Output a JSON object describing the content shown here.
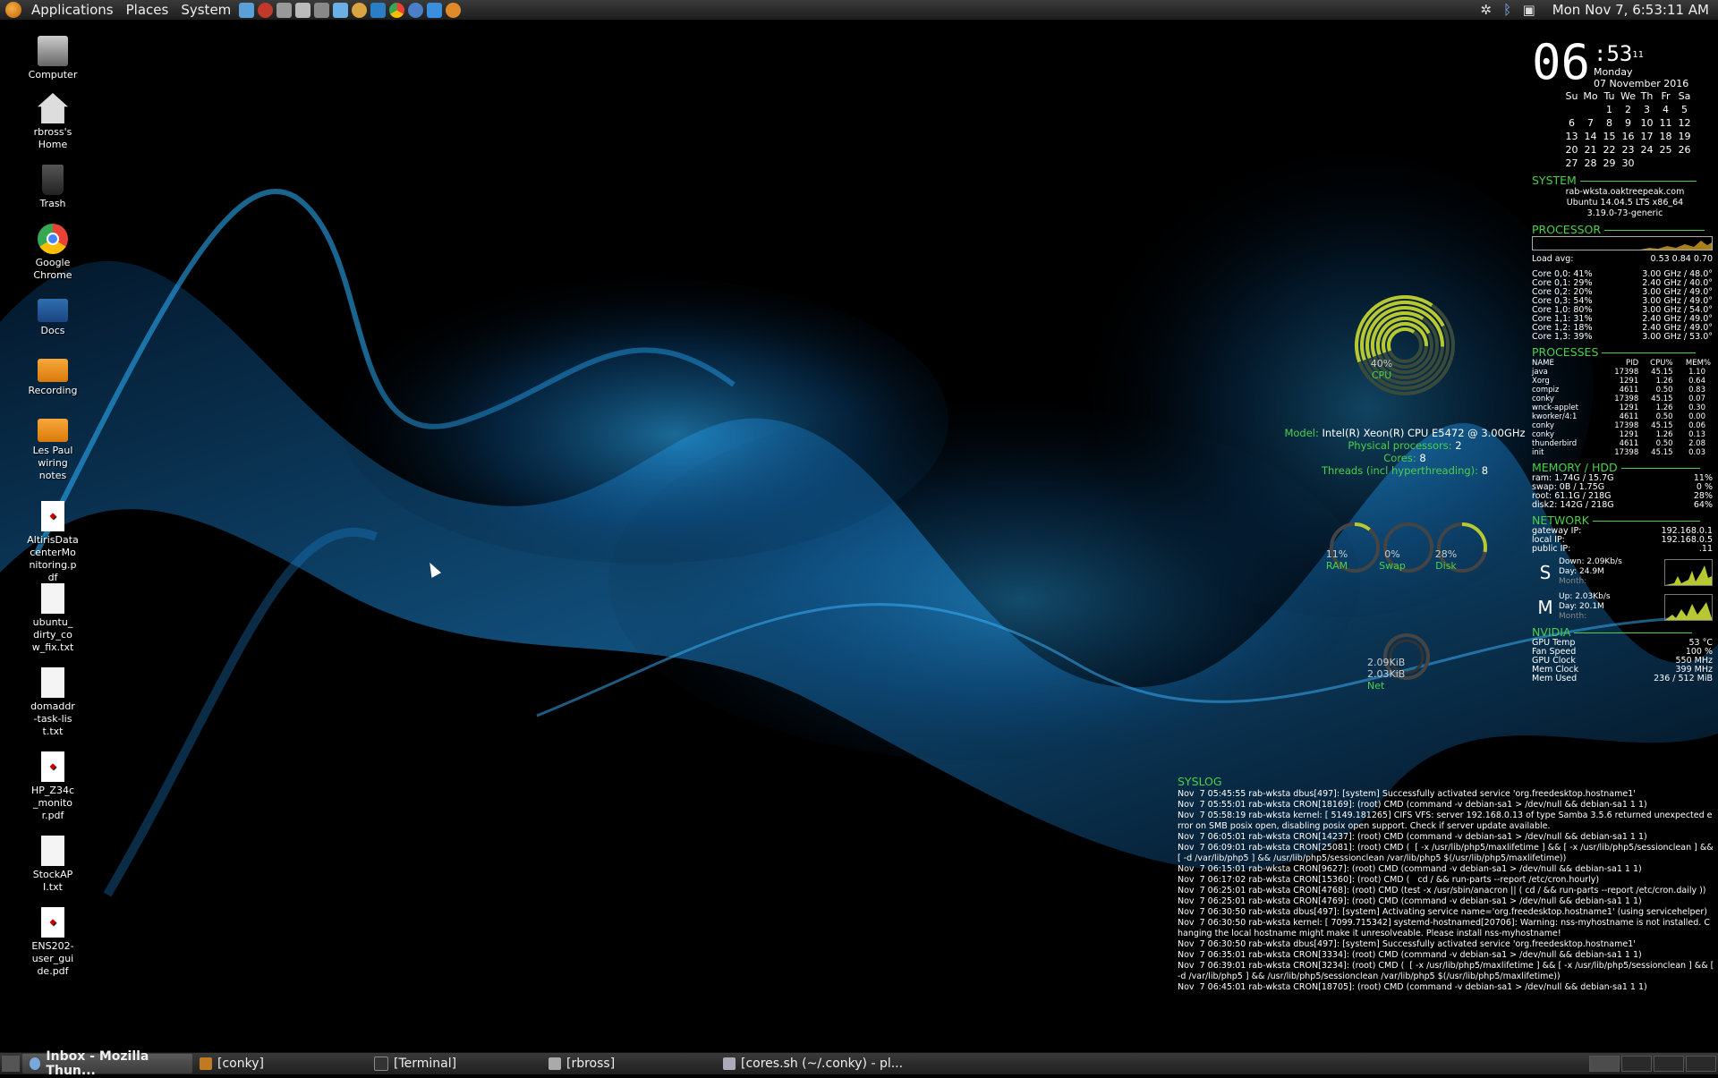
{
  "top_panel": {
    "menus": [
      "Applications",
      "Places",
      "System"
    ],
    "launchers": [
      "virtualbox-icon",
      "app-icon",
      "screenshot-icon",
      "files-icon",
      "window-icon",
      "chromium-icon",
      "thunderbird-icon",
      "network-icon",
      "chrome-icon",
      "firefox-icon",
      "writer-icon",
      "updater-icon"
    ],
    "datetime": "Mon Nov  7,  6:53:11 AM"
  },
  "desktop_icons": [
    {
      "label": "Computer",
      "icon": "computer-icon"
    },
    {
      "label": "rbross's Home",
      "icon": "home-icon"
    },
    {
      "label": "Trash",
      "icon": "trash-icon"
    },
    {
      "label": "Google Chrome",
      "icon": "chrome-icon"
    },
    {
      "label": "Docs",
      "icon": "folder-link-icon"
    },
    {
      "label": "Recording",
      "icon": "folder-icon"
    },
    {
      "label": "Les Paul wiring notes",
      "icon": "folder-icon"
    },
    {
      "label": "AltirisDatacenterMonitoring.pdf",
      "icon": "pdf-icon"
    },
    {
      "label": "ubuntu_dirty_cow_fix.txt",
      "icon": "text-file-icon"
    },
    {
      "label": "domaddr-task-list.txt",
      "icon": "text-file-icon"
    },
    {
      "label": "HP_Z34c_monitor.pdf",
      "icon": "pdf-icon"
    },
    {
      "label": "StockAPI.txt",
      "icon": "text-file-icon"
    },
    {
      "label": "ENS202-user_guide.pdf",
      "icon": "pdf-icon"
    }
  ],
  "conky": {
    "clock": {
      "hour": "06",
      "minute": ":53",
      "second": "11",
      "weekday": "Monday",
      "date": "07 November 2016"
    },
    "calendar": {
      "headers": [
        "Su",
        "Mo",
        "Tu",
        "We",
        "Th",
        "Fr",
        "Sa"
      ],
      "weeks": [
        [
          "",
          "",
          "1",
          "2",
          "3",
          "4",
          "5"
        ],
        [
          "6",
          "7",
          "8",
          "9",
          "10",
          "11",
          "12"
        ],
        [
          "13",
          "14",
          "15",
          "16",
          "17",
          "18",
          "19"
        ],
        [
          "20",
          "21",
          "22",
          "23",
          "24",
          "25",
          "26"
        ],
        [
          "27",
          "28",
          "29",
          "30",
          "",
          "",
          ""
        ]
      ]
    },
    "system": {
      "title": "SYSTEM",
      "host": "rab-wksta.oaktreepeak.com",
      "os": "Ubuntu 14.04.5 LTS x86_64",
      "kernel": "3.19.0-73-generic"
    },
    "processor": {
      "title": "PROCESSOR",
      "load_label": "Load avg:",
      "load_value": "0.53 0.84 0.70",
      "cores": [
        {
          "name": "Core 0,0:",
          "pct": "41%",
          "freq": "3.00 GHz / 48.0°"
        },
        {
          "name": "Core 0,1:",
          "pct": "29%",
          "freq": "2.40 GHz / 40.0°"
        },
        {
          "name": "Core 0,2:",
          "pct": "20%",
          "freq": "3.00 GHz / 49.0°"
        },
        {
          "name": "Core 0,3:",
          "pct": "54%",
          "freq": "3.00 GHz / 49.0°"
        },
        {
          "name": "Core 1,0:",
          "pct": "80%",
          "freq": "3.00 GHz / 54.0°"
        },
        {
          "name": "Core 1,1:",
          "pct": "31%",
          "freq": "2.40 GHz / 49.0°"
        },
        {
          "name": "Core 1,2:",
          "pct": "18%",
          "freq": "2.40 GHz / 49.0°"
        },
        {
          "name": "Core 1,3:",
          "pct": "39%",
          "freq": "3.00 GHz / 53.0°"
        }
      ]
    },
    "processes": {
      "title": "PROCESSES",
      "headers": [
        "NAME",
        "PID",
        "CPU%",
        "MEM%"
      ],
      "rows": [
        [
          "java",
          "17398",
          "45.15",
          "1.10"
        ],
        [
          "Xorg",
          "1291",
          "1.26",
          "0.64"
        ],
        [
          "compiz",
          "4611",
          "0.50",
          "0.83"
        ],
        [
          "conky",
          "17398",
          "45.15",
          "0.07"
        ],
        [
          "wnck-applet",
          "1291",
          "1.26",
          "0.30"
        ],
        [
          "kworker/4:1",
          "4611",
          "0.50",
          "0.00"
        ],
        [
          "conky",
          "17398",
          "45.15",
          "0.06"
        ],
        [
          "conky",
          "1291",
          "1.26",
          "0.13"
        ],
        [
          "thunderbird",
          "4611",
          "0.50",
          "2.08"
        ],
        [
          "init",
          "17398",
          "45.15",
          "0.03"
        ]
      ]
    },
    "memory": {
      "title": "MEMORY / HDD",
      "rows": [
        {
          "label": "ram: 1.74G / 15.7G",
          "value": "11%"
        },
        {
          "label": "swap: 0B   / 1.75G",
          "value": "0 %"
        },
        {
          "label": "root: 61.1G / 218G",
          "value": "28%"
        },
        {
          "label": "disk2: 142G  / 218G",
          "value": "64%"
        }
      ]
    },
    "network": {
      "title": "NETWORK",
      "rows": [
        {
          "label": "gateway IP:",
          "value": "192.168.0.1"
        },
        {
          "label": "local IP:",
          "value": "192.168.0.5"
        },
        {
          "label": "public IP:",
          "value": ".11"
        }
      ],
      "down": {
        "letter": "S",
        "line1": "Down: 2.09Kb/s",
        "line2": "Day: 24.9M",
        "line3": "Month:"
      },
      "up": {
        "letter": "M",
        "line1": "Up: 2.03Kb/s",
        "line2": "Day: 20.1M",
        "line3": "Month:"
      }
    },
    "nvidia": {
      "title": "NVIDIA",
      "rows": [
        {
          "label": "GPU Temp",
          "value": "53  °C"
        },
        {
          "label": "Fan Speed",
          "value": "100 %"
        },
        {
          "label": "GPU Clock",
          "value": "550 MHz"
        },
        {
          "label": "Mem Clock",
          "value": "399 MHz"
        },
        {
          "label": "Mem Used",
          "value": "236 / 512 MiB"
        }
      ]
    },
    "cpu_ring": {
      "pct": "40%",
      "label": "CPU",
      "level": 0.4
    },
    "cpu_info": {
      "model_label": "Model:",
      "model": "Intel(R) Xeon(R) CPU E5472 @ 3.00GHz",
      "phys_label": "Physical processors:",
      "phys": "2",
      "cores_label": "Cores:",
      "cores": "8",
      "threads_label": "Threads (incl hyperthreading):",
      "threads": "8"
    },
    "rings": [
      {
        "pct": "11%",
        "label": "RAM",
        "level": 0.11
      },
      {
        "pct": "0%",
        "label": "Swap",
        "level": 0.0
      },
      {
        "pct": "28%",
        "label": "Disk",
        "level": 0.28
      }
    ],
    "net_ring": {
      "down": "2.09KiB",
      "up": "2.03KiB",
      "label": "Net"
    }
  },
  "syslog": {
    "title": "SYSLOG",
    "lines": [
      "Nov  7 05:45:55 rab-wksta dbus[497]: [system] Successfully activated service 'org.freedesktop.hostname1'",
      "Nov  7 05:55:01 rab-wksta CRON[18169]: (root) CMD (command -v debian-sa1 > /dev/null && debian-sa1 1 1)",
      "Nov  7 05:58:19 rab-wksta kernel: [ 5149.181265] CIFS VFS: server 192.168.0.13 of type Samba 3.5.6 returned unexpected error on SMB posix open, disabling posix open support. Check if server update available.",
      "Nov  7 06:05:01 rab-wksta CRON[14237]: (root) CMD (command -v debian-sa1 > /dev/null && debian-sa1 1 1)",
      "Nov  7 06:09:01 rab-wksta CRON[25081]: (root) CMD (  [ -x /usr/lib/php5/maxlifetime ] && [ -x /usr/lib/php5/sessionclean ] && [ -d /var/lib/php5 ] && /usr/lib/php5/sessionclean /var/lib/php5 $(/usr/lib/php5/maxlifetime))",
      "Nov  7 06:15:01 rab-wksta CRON[9627]: (root) CMD (command -v debian-sa1 > /dev/null && debian-sa1 1 1)",
      "Nov  7 06:17:02 rab-wksta CRON[15360]: (root) CMD (   cd / && run-parts --report /etc/cron.hourly)",
      "Nov  7 06:25:01 rab-wksta CRON[4768]: (root) CMD (test -x /usr/sbin/anacron || ( cd / && run-parts --report /etc/cron.daily ))",
      "Nov  7 06:25:01 rab-wksta CRON[4769]: (root) CMD (command -v debian-sa1 > /dev/null && debian-sa1 1 1)",
      "Nov  7 06:30:50 rab-wksta dbus[497]: [system] Activating service name='org.freedesktop.hostname1' (using servicehelper)",
      "Nov  7 06:30:50 rab-wksta kernel: [ 7099.715342] systemd-hostnamed[20706]: Warning: nss-myhostname is not installed. Changing the local hostname might make it unresolveable. Please install nss-myhostname!",
      "Nov  7 06:30:50 rab-wksta dbus[497]: [system] Successfully activated service 'org.freedesktop.hostname1'",
      "Nov  7 06:35:01 rab-wksta CRON[3334]: (root) CMD (command -v debian-sa1 > /dev/null && debian-sa1 1 1)",
      "Nov  7 06:39:01 rab-wksta CRON[3234]: (root) CMD (  [ -x /usr/lib/php5/maxlifetime ] && [ -x /usr/lib/php5/sessionclean ] && [ -d /var/lib/php5 ] && /usr/lib/php5/sessionclean /var/lib/php5 $(/usr/lib/php5/maxlifetime))",
      "Nov  7 06:45:01 rab-wksta CRON[18705]: (root) CMD (command -v debian-sa1 > /dev/null && debian-sa1 1 1)"
    ]
  },
  "taskbar": {
    "tasks": [
      {
        "label": "Inbox - Mozilla Thun...",
        "icon": "thunderbird-icon",
        "active": true
      },
      {
        "label": "[conky]",
        "icon": "folder-icon",
        "active": false
      },
      {
        "label": "[Terminal]",
        "icon": "terminal-icon",
        "active": false
      },
      {
        "label": "[rbross]",
        "icon": "home-icon",
        "active": false
      },
      {
        "label": "[cores.sh (~/.conky) - pl...",
        "icon": "text-editor-icon",
        "active": false
      }
    ],
    "workspaces": 4
  },
  "colors": {
    "accent": "#4ad04a",
    "ring": "#b8c832",
    "wallpaper_blue": "#1a8fd8"
  }
}
